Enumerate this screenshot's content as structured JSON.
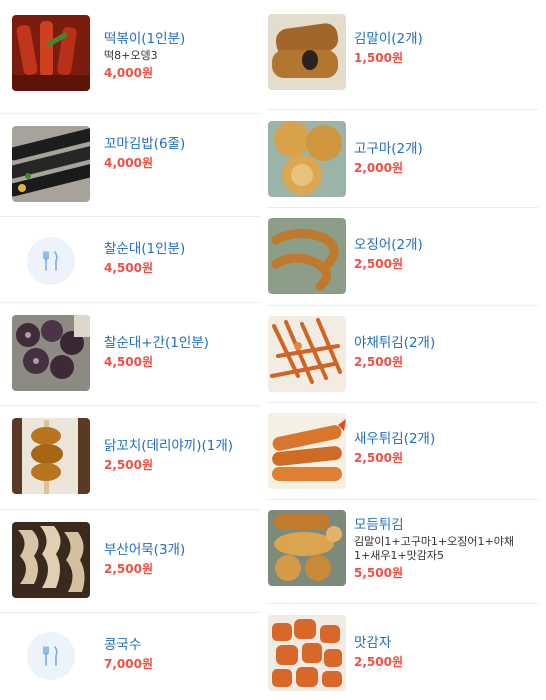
{
  "left_menu": [
    {
      "name": "떡볶이(1인분)",
      "desc": "떡8+오뎅3",
      "price": "4,000원"
    },
    {
      "name": "꼬마김밥(6줄)",
      "price": "4,000원"
    },
    {
      "name": "찰순대(1인분)",
      "price": "4,500원",
      "icon": "fork-knife-icon"
    },
    {
      "name": "찰순대+간(1인분)",
      "price": "4,500원"
    },
    {
      "name": "닭꼬치(데리야끼)(1개)",
      "price": "2,500원"
    },
    {
      "name": "부산어묵(3개)",
      "price": "2,500원"
    },
    {
      "name": "콩국수",
      "price": "7,000원",
      "icon": "fork-knife-icon"
    }
  ],
  "right_menu": [
    {
      "name": "김말이(2개)",
      "price": "1,500원"
    },
    {
      "name": "고구마(2개)",
      "price": "2,000원"
    },
    {
      "name": "오징어(2개)",
      "price": "2,500원"
    },
    {
      "name": "야채튀김(2개)",
      "price": "2,500원"
    },
    {
      "name": "새우튀김(2개)",
      "price": "2,500원"
    },
    {
      "name": "모듬튀김",
      "desc": "김말이1+고구마1+오징어1+야채1+새우1+맛감자5",
      "price": "5,500원"
    },
    {
      "name": "맛감자",
      "price": "2,500원"
    }
  ],
  "colors": {
    "name": "#1f6fc0",
    "price": "#f04f43",
    "placeholder_bg": "#edf3fb",
    "placeholder_icon": "#7aaee8"
  }
}
